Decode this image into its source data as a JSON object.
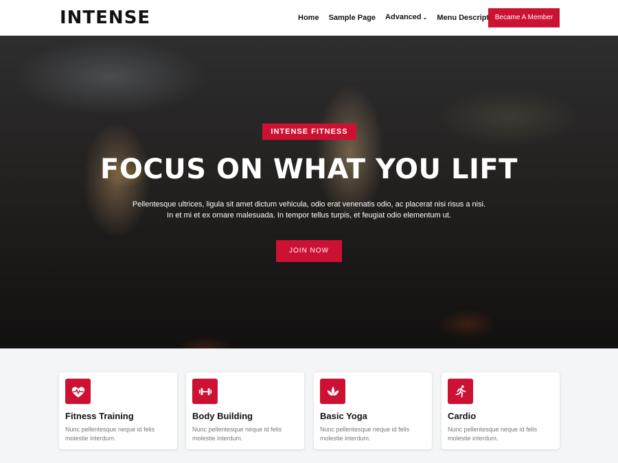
{
  "header": {
    "logo": "INTENSE",
    "nav": [
      {
        "label": "Home"
      },
      {
        "label": "Sample Page"
      },
      {
        "label": "Advanced"
      },
      {
        "label": "Menu Description"
      }
    ],
    "cta_label": "Became A Member"
  },
  "hero": {
    "tag": "INTENSE FITNESS",
    "title": "FOCUS ON WHAT YOU LIFT",
    "text_line1": "Pellentesque ultrices, ligula sit amet dictum vehicula, odio erat venenatis odio, ac placerat nisi risus a nisi.",
    "text_line2": "In et mi et ex ornare malesuada. In tempor tellus turpis, et feugiat odio elementum ut.",
    "button_label": "JOIN NOW"
  },
  "features": [
    {
      "title": "Fitness Training",
      "text": "Nunc pellentesque neque id felis molestie interdum.",
      "icon": "heart-pulse-icon"
    },
    {
      "title": "Body Building",
      "text": "Nunc pellentesque neque id felis molestie interdum.",
      "icon": "dumbbell-icon"
    },
    {
      "title": "Basic Yoga",
      "text": "Nunc pellentesque neque id felis molestie interdum.",
      "icon": "lotus-icon"
    },
    {
      "title": "Cardio",
      "text": "Nunc pellentesque neque id felis molestie interdum.",
      "icon": "running-icon"
    }
  ],
  "colors": {
    "accent": "#cc1133"
  }
}
